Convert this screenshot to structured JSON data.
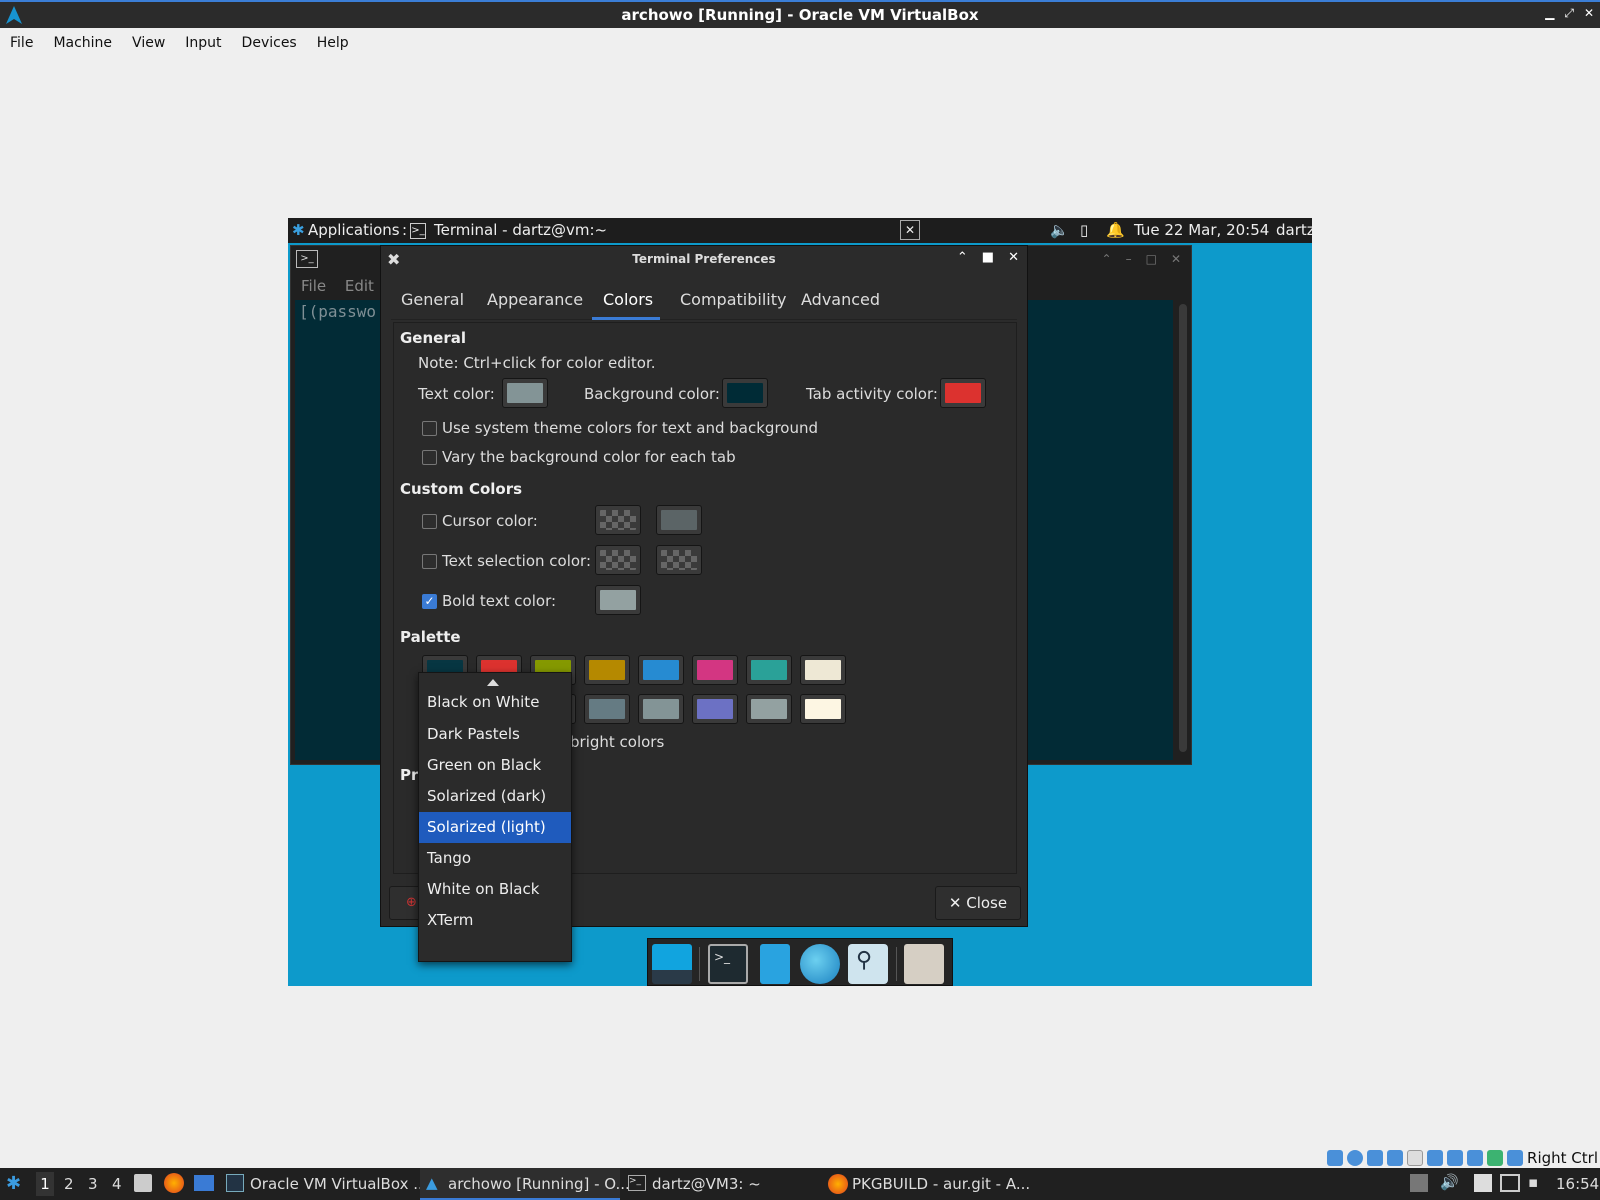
{
  "host": {
    "title": "archowo [Running] - Oracle VM VirtualBox",
    "menu": [
      "File",
      "Machine",
      "View",
      "Input",
      "Devices",
      "Help"
    ],
    "host_key": "Right Ctrl"
  },
  "vm": {
    "panel": {
      "applications": "Applications",
      "separator": ":",
      "window_title": "Terminal - dartz@vm:~",
      "clock": "Tue 22 Mar, 20:54",
      "user": "dartz"
    },
    "terminal": {
      "menu_file": "File",
      "menu_edit": "Edit",
      "text": "[(passwo"
    }
  },
  "prefs": {
    "title": "Terminal Preferences",
    "tabs": [
      "General",
      "Appearance",
      "Colors",
      "Compatibility",
      "Advanced"
    ],
    "active_tab": "Colors",
    "general": {
      "heading": "General",
      "note": "Note: Ctrl+click for color editor.",
      "text_color_label": "Text color:",
      "bg_color_label": "Background color:",
      "tab_activity_label": "Tab activity color:",
      "use_system_label": "Use system theme colors for text and background",
      "vary_bg_label": "Vary the background color for each tab"
    },
    "custom": {
      "heading": "Custom Colors",
      "cursor_label": "Cursor color:",
      "selection_label": "Text selection color:",
      "bold_label": "Bold text color:"
    },
    "palette": {
      "heading": "Palette",
      "bright_label_partial": "bright colors",
      "presets_partial": "Pr"
    },
    "close_label": "✕ Close"
  },
  "colors": {
    "text": "#839496",
    "background": "#002b36",
    "tab_activity": "#dc322f",
    "cursor_right": "#5b6466",
    "bold": "#93a1a1",
    "palette_row1": [
      "#073642",
      "#dc322f",
      "#859900",
      "#b58900",
      "#268bd2",
      "#d33682",
      "#2aa198",
      "#eee8d5"
    ],
    "palette_row2": [
      "#002b36",
      "#cb4b16",
      "#586e75",
      "#657b83",
      "#839496",
      "#6c71c4",
      "#93a1a1",
      "#fdf6e3"
    ]
  },
  "dropdown": {
    "items": [
      "Black on White",
      "Dark Pastels",
      "Green on Black",
      "Solarized (dark)",
      "Solarized (light)",
      "Tango",
      "White on Black",
      "XTerm"
    ],
    "selected": "Solarized (light)"
  },
  "taskbar": {
    "workspaces": [
      "1",
      "2",
      "3",
      "4"
    ],
    "windows": [
      "Oracle VM VirtualBox ...",
      "archowo [Running] - O...",
      "dartz@VM3: ~",
      "PKGBUILD - aur.git - A..."
    ],
    "clock": "16:54"
  }
}
